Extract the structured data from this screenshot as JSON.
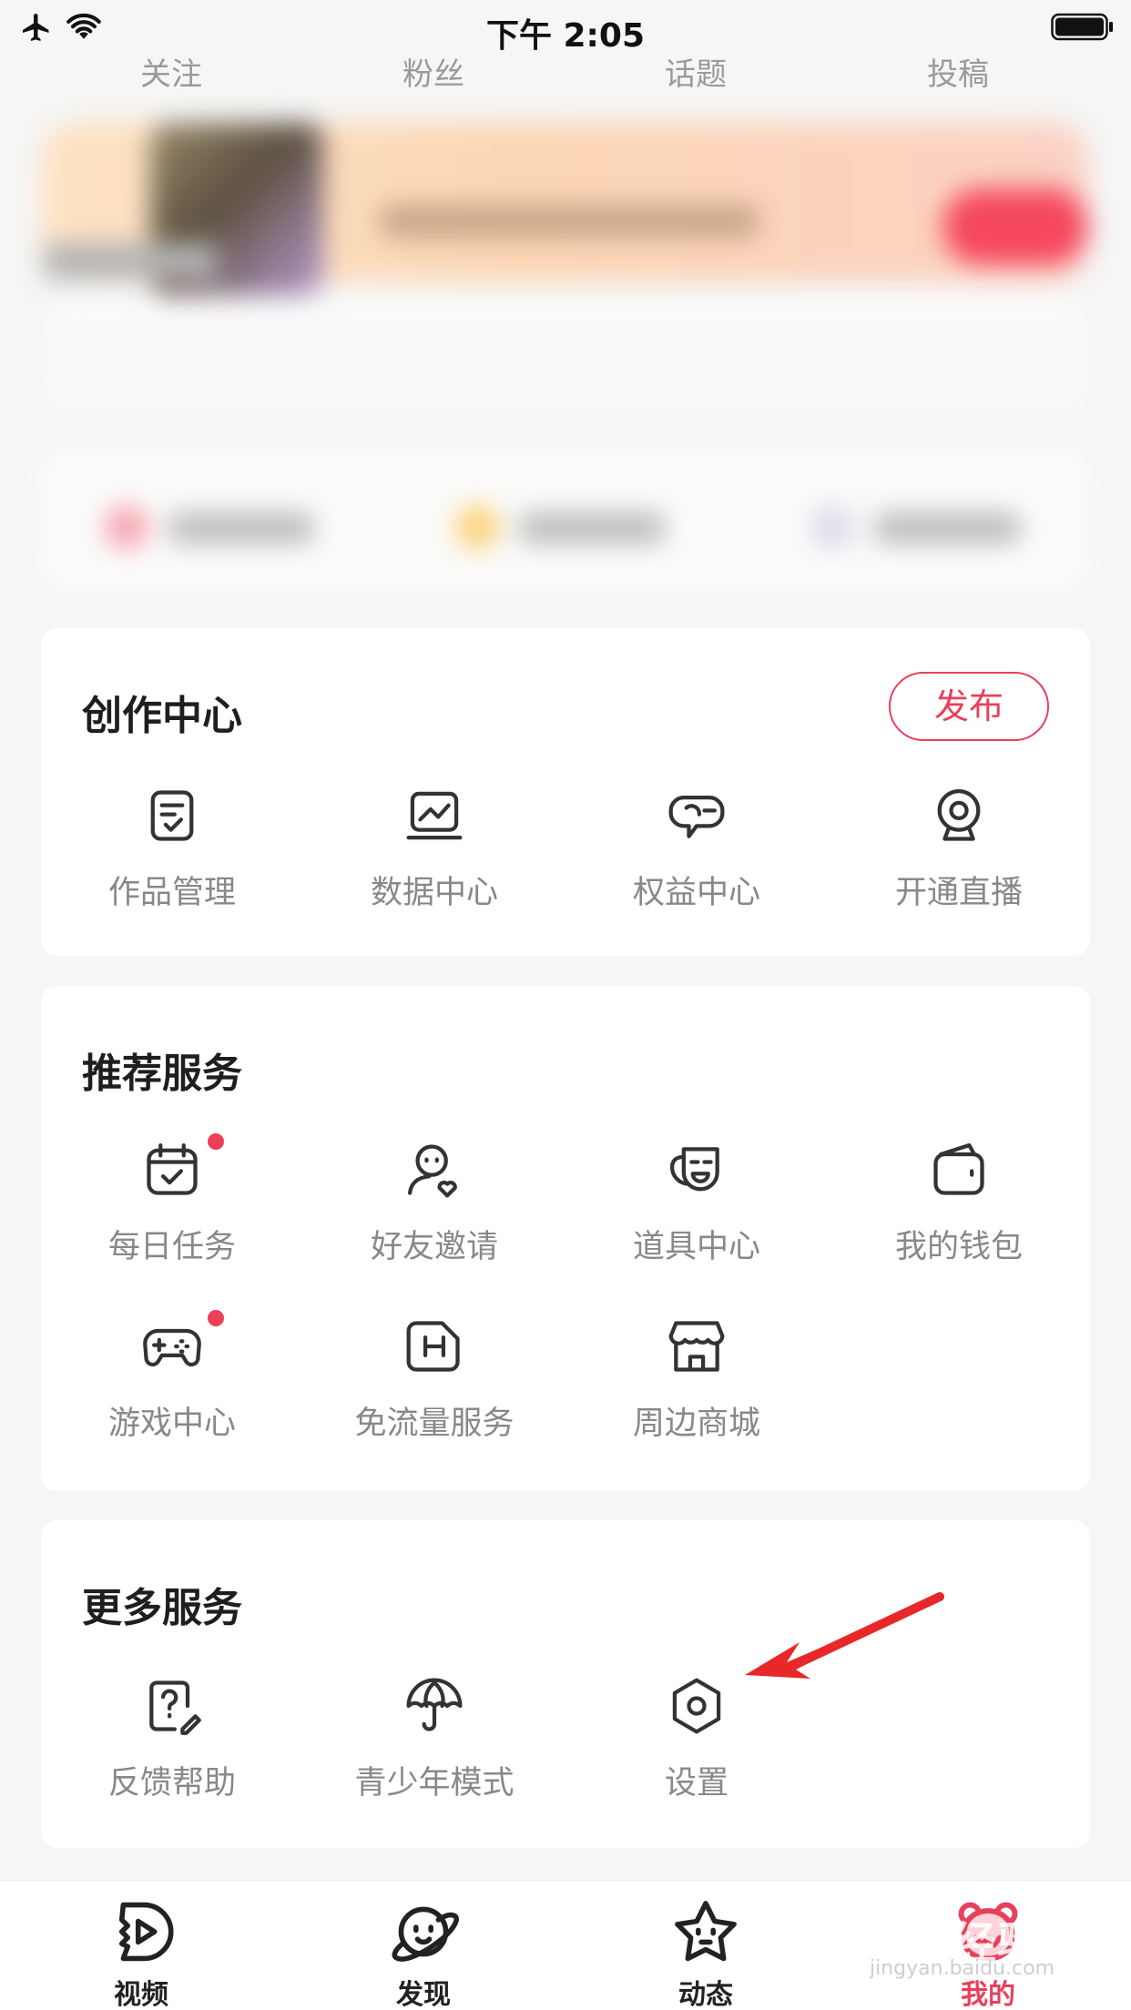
{
  "status_bar": {
    "time": "下午 2:05"
  },
  "top_tabs": [
    "关注",
    "粉丝",
    "话题",
    "投稿"
  ],
  "creation_center": {
    "title": "创作中心",
    "publish_label": "发布",
    "items": [
      {
        "label": "作品管理",
        "icon": "works-manage-icon"
      },
      {
        "label": "数据中心",
        "icon": "data-chart-icon"
      },
      {
        "label": "权益中心",
        "icon": "rights-icon"
      },
      {
        "label": "开通直播",
        "icon": "live-camera-icon"
      }
    ]
  },
  "recommended_services": {
    "title": "推荐服务",
    "items": [
      {
        "label": "每日任务",
        "icon": "calendar-check-icon",
        "badge": true
      },
      {
        "label": "好友邀请",
        "icon": "invite-friend-icon",
        "badge": false
      },
      {
        "label": "道具中心",
        "icon": "mask-icon",
        "badge": false
      },
      {
        "label": "我的钱包",
        "icon": "wallet-icon",
        "badge": false
      },
      {
        "label": "游戏中心",
        "icon": "gamepad-icon",
        "badge": true
      },
      {
        "label": "免流量服务",
        "icon": "sim-card-icon",
        "badge": false
      },
      {
        "label": "周边商城",
        "icon": "shop-icon",
        "badge": false
      }
    ]
  },
  "more_services": {
    "title": "更多服务",
    "items": [
      {
        "label": "反馈帮助",
        "icon": "help-feedback-icon"
      },
      {
        "label": "青少年模式",
        "icon": "umbrella-icon"
      },
      {
        "label": "设置",
        "icon": "settings-hexagon-icon"
      }
    ]
  },
  "bottom_nav": [
    {
      "label": "视频",
      "icon": "video-play-icon",
      "active": false
    },
    {
      "label": "发现",
      "icon": "planet-icon",
      "active": false
    },
    {
      "label": "动态",
      "icon": "star-face-icon",
      "active": false
    },
    {
      "label": "我的",
      "icon": "profile-mascot-icon",
      "active": true
    }
  ],
  "watermark": {
    "main": "Bai 经验",
    "sub": "jingyan.baidu.com"
  },
  "colors": {
    "accent": "#e8405a",
    "badge": "#ef3e57",
    "icon": "#333333",
    "label_gray": "#888888"
  }
}
